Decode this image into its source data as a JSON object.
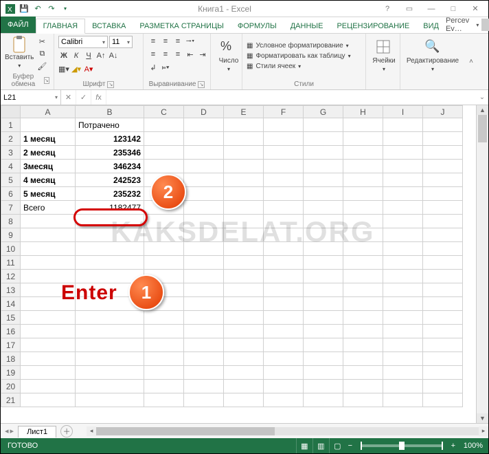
{
  "titlebar": {
    "title": "Книга1 - Excel"
  },
  "user": {
    "name": "Percev Ev…"
  },
  "tabs": {
    "file": "ФАЙЛ",
    "items": [
      "ГЛАВНАЯ",
      "ВСТАВКА",
      "РАЗМЕТКА СТРАНИЦЫ",
      "ФОРМУЛЫ",
      "ДАННЫЕ",
      "РЕЦЕНЗИРОВАНИЕ",
      "ВИД"
    ]
  },
  "ribbon": {
    "clipboard": {
      "paste": "Вставить",
      "group": "Буфер обмена"
    },
    "font": {
      "name": "Calibri",
      "size": "11",
      "group": "Шрифт",
      "b": "Ж",
      "i": "К",
      "u": "Ч"
    },
    "align": {
      "group": "Выравнивание"
    },
    "number": {
      "label": "Число"
    },
    "styles": {
      "cond": "Условное форматирование",
      "table": "Форматировать как таблицу",
      "cell": "Стили ячеек",
      "group": "Стили"
    },
    "cells": {
      "label": "Ячейки"
    },
    "editing": {
      "label": "Редактирование"
    }
  },
  "namebox": {
    "ref": "L21"
  },
  "columns": [
    "A",
    "B",
    "C",
    "D",
    "E",
    "F",
    "G",
    "H",
    "I",
    "J"
  ],
  "sheet": {
    "B1": "Потрачено",
    "rows": [
      {
        "a": "1 месяц",
        "b": "123142"
      },
      {
        "a": "2 месяц",
        "b": "235346"
      },
      {
        "a": "3месяц",
        "b": "346234"
      },
      {
        "a": "4 месяц",
        "b": "242523"
      },
      {
        "a": "5 месяц",
        "b": "235232"
      }
    ],
    "total_label": "Всего",
    "total_value": "1182477"
  },
  "chart_data": {
    "type": "table",
    "title": "Потрачено",
    "categories": [
      "1 месяц",
      "2 месяц",
      "3месяц",
      "4 месяц",
      "5 месяц"
    ],
    "values": [
      123142,
      235346,
      346234,
      242523,
      235232
    ],
    "total": 1182477
  },
  "annotations": {
    "enter": "Enter",
    "c1": "1",
    "c2": "2",
    "watermark": "KAKSDELAT.ORG"
  },
  "sheettab": {
    "name": "Лист1"
  },
  "status": {
    "ready": "ГОТОВО",
    "zoom": "100%"
  }
}
